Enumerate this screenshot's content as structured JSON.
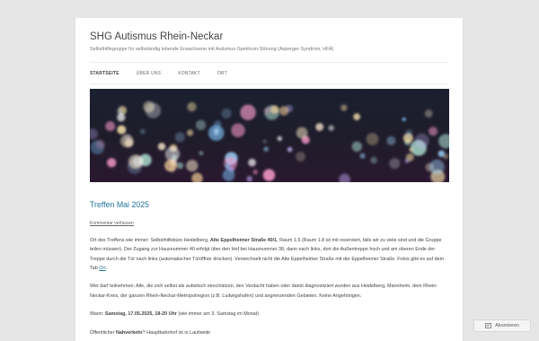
{
  "site": {
    "title": "SHG Autismus Rhein-Neckar",
    "description": "Selbsthilfegruppe für selbständig lebende Erwachsene mit Autismus-Spektrum-Störung (Asperger-Syndrom, HFA)"
  },
  "nav": {
    "items": [
      {
        "label": "STARTSEITE",
        "active": true
      },
      {
        "label": "ÜBER UNS",
        "active": false
      },
      {
        "label": "KONTAKT",
        "active": false
      },
      {
        "label": "ORT",
        "active": false
      }
    ]
  },
  "post": {
    "title": "Treffen Mai 2025",
    "comment_link": "Kommentar verfassen",
    "p1": {
      "a": "Ort des Treffens wie immer: Selbsthilfebüro Heidelberg, ",
      "b": "Alte Eppelheimer Straße 40/1",
      "c": ", Raum 1.6 (Raum 1.8 ist mit reserviert, falls wir zu viele sind und die Gruppe teilen müssen). Der Zugang zur Hausnummer 40 erfolgt über den Hof bei Hausnummer 38, dann nach links, dort die Außentreppe hoch und am oberen Ende der Treppe durch die Tür nach links (automatischer Türöffner drücken). Verwechselt nicht die Alte Eppelheimer Straße mit der Eppelheimer Straße. Fotos gibt es auf dem Tab ",
      "link": "Ort",
      "d": "."
    },
    "p2": "Wer darf teilnehmen: Alle, die sich selbst als autistisch einschätzen, den Verdacht haben oder damit diagnostiziert wurden aus Heidelberg, Mannheim, dem Rhein-Neckar-Kreis, der ganzen Rhein-Neckar-Metropolregion (z.B. Ludwigshafen) und angrenzenden Gebieten. Keine Angehörigen.",
    "p3": {
      "a": "Wann: ",
      "b": "Samstag, 17.05.2025, 18-20 Uhr",
      "c": " (wie immer am 3. Samstag im Monat)"
    },
    "p4": {
      "a": "Öffentlicher ",
      "b": "Nahverkehr",
      "c": "? Hauptbahnhof ist in Laufweite"
    }
  },
  "follow": {
    "label": "Abonnieren",
    "icon": "follow-icon"
  },
  "colors": {
    "link": "#21759b",
    "background": "#e6e6e6"
  }
}
